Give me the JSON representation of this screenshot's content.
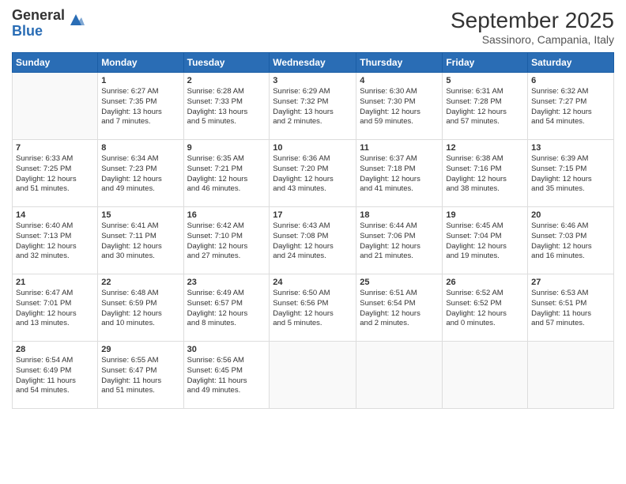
{
  "logo": {
    "general": "General",
    "blue": "Blue"
  },
  "header": {
    "month": "September 2025",
    "location": "Sassinoro, Campania, Italy"
  },
  "weekdays": [
    "Sunday",
    "Monday",
    "Tuesday",
    "Wednesday",
    "Thursday",
    "Friday",
    "Saturday"
  ],
  "weeks": [
    [
      {
        "day": "",
        "info": ""
      },
      {
        "day": "1",
        "info": "Sunrise: 6:27 AM\nSunset: 7:35 PM\nDaylight: 13 hours\nand 7 minutes."
      },
      {
        "day": "2",
        "info": "Sunrise: 6:28 AM\nSunset: 7:33 PM\nDaylight: 13 hours\nand 5 minutes."
      },
      {
        "day": "3",
        "info": "Sunrise: 6:29 AM\nSunset: 7:32 PM\nDaylight: 13 hours\nand 2 minutes."
      },
      {
        "day": "4",
        "info": "Sunrise: 6:30 AM\nSunset: 7:30 PM\nDaylight: 12 hours\nand 59 minutes."
      },
      {
        "day": "5",
        "info": "Sunrise: 6:31 AM\nSunset: 7:28 PM\nDaylight: 12 hours\nand 57 minutes."
      },
      {
        "day": "6",
        "info": "Sunrise: 6:32 AM\nSunset: 7:27 PM\nDaylight: 12 hours\nand 54 minutes."
      }
    ],
    [
      {
        "day": "7",
        "info": "Sunrise: 6:33 AM\nSunset: 7:25 PM\nDaylight: 12 hours\nand 51 minutes."
      },
      {
        "day": "8",
        "info": "Sunrise: 6:34 AM\nSunset: 7:23 PM\nDaylight: 12 hours\nand 49 minutes."
      },
      {
        "day": "9",
        "info": "Sunrise: 6:35 AM\nSunset: 7:21 PM\nDaylight: 12 hours\nand 46 minutes."
      },
      {
        "day": "10",
        "info": "Sunrise: 6:36 AM\nSunset: 7:20 PM\nDaylight: 12 hours\nand 43 minutes."
      },
      {
        "day": "11",
        "info": "Sunrise: 6:37 AM\nSunset: 7:18 PM\nDaylight: 12 hours\nand 41 minutes."
      },
      {
        "day": "12",
        "info": "Sunrise: 6:38 AM\nSunset: 7:16 PM\nDaylight: 12 hours\nand 38 minutes."
      },
      {
        "day": "13",
        "info": "Sunrise: 6:39 AM\nSunset: 7:15 PM\nDaylight: 12 hours\nand 35 minutes."
      }
    ],
    [
      {
        "day": "14",
        "info": "Sunrise: 6:40 AM\nSunset: 7:13 PM\nDaylight: 12 hours\nand 32 minutes."
      },
      {
        "day": "15",
        "info": "Sunrise: 6:41 AM\nSunset: 7:11 PM\nDaylight: 12 hours\nand 30 minutes."
      },
      {
        "day": "16",
        "info": "Sunrise: 6:42 AM\nSunset: 7:10 PM\nDaylight: 12 hours\nand 27 minutes."
      },
      {
        "day": "17",
        "info": "Sunrise: 6:43 AM\nSunset: 7:08 PM\nDaylight: 12 hours\nand 24 minutes."
      },
      {
        "day": "18",
        "info": "Sunrise: 6:44 AM\nSunset: 7:06 PM\nDaylight: 12 hours\nand 21 minutes."
      },
      {
        "day": "19",
        "info": "Sunrise: 6:45 AM\nSunset: 7:04 PM\nDaylight: 12 hours\nand 19 minutes."
      },
      {
        "day": "20",
        "info": "Sunrise: 6:46 AM\nSunset: 7:03 PM\nDaylight: 12 hours\nand 16 minutes."
      }
    ],
    [
      {
        "day": "21",
        "info": "Sunrise: 6:47 AM\nSunset: 7:01 PM\nDaylight: 12 hours\nand 13 minutes."
      },
      {
        "day": "22",
        "info": "Sunrise: 6:48 AM\nSunset: 6:59 PM\nDaylight: 12 hours\nand 10 minutes."
      },
      {
        "day": "23",
        "info": "Sunrise: 6:49 AM\nSunset: 6:57 PM\nDaylight: 12 hours\nand 8 minutes."
      },
      {
        "day": "24",
        "info": "Sunrise: 6:50 AM\nSunset: 6:56 PM\nDaylight: 12 hours\nand 5 minutes."
      },
      {
        "day": "25",
        "info": "Sunrise: 6:51 AM\nSunset: 6:54 PM\nDaylight: 12 hours\nand 2 minutes."
      },
      {
        "day": "26",
        "info": "Sunrise: 6:52 AM\nSunset: 6:52 PM\nDaylight: 12 hours\nand 0 minutes."
      },
      {
        "day": "27",
        "info": "Sunrise: 6:53 AM\nSunset: 6:51 PM\nDaylight: 11 hours\nand 57 minutes."
      }
    ],
    [
      {
        "day": "28",
        "info": "Sunrise: 6:54 AM\nSunset: 6:49 PM\nDaylight: 11 hours\nand 54 minutes."
      },
      {
        "day": "29",
        "info": "Sunrise: 6:55 AM\nSunset: 6:47 PM\nDaylight: 11 hours\nand 51 minutes."
      },
      {
        "day": "30",
        "info": "Sunrise: 6:56 AM\nSunset: 6:45 PM\nDaylight: 11 hours\nand 49 minutes."
      },
      {
        "day": "",
        "info": ""
      },
      {
        "day": "",
        "info": ""
      },
      {
        "day": "",
        "info": ""
      },
      {
        "day": "",
        "info": ""
      }
    ]
  ]
}
